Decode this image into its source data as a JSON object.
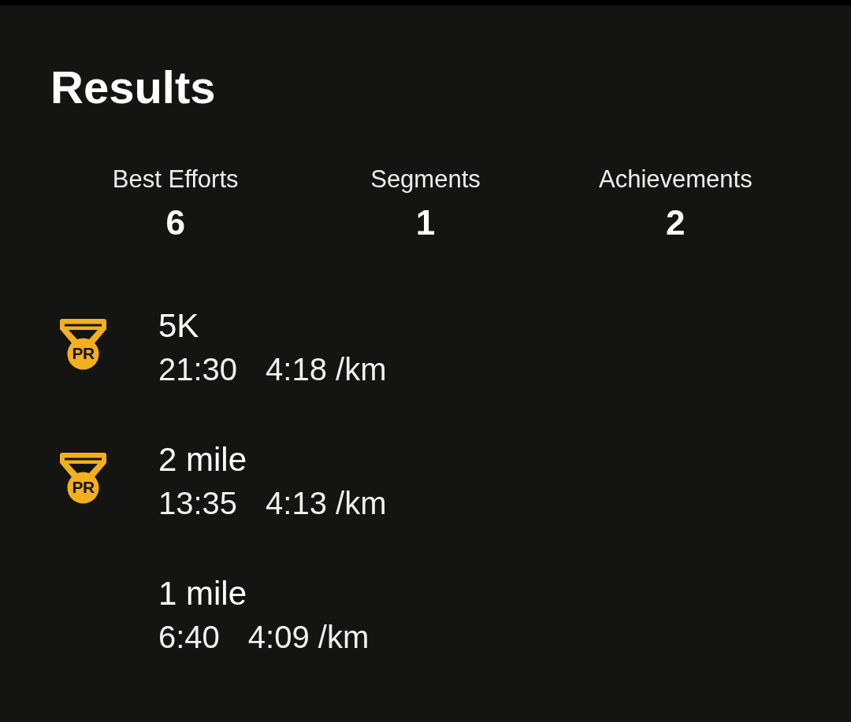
{
  "title": "Results",
  "stats": [
    {
      "label": "Best Efforts",
      "value": "6"
    },
    {
      "label": "Segments",
      "value": "1"
    },
    {
      "label": "Achievements",
      "value": "2"
    }
  ],
  "efforts": [
    {
      "badge": "PR",
      "name": "5K",
      "time": "21:30",
      "pace": "4:18 /km"
    },
    {
      "badge": "PR",
      "name": "2 mile",
      "time": "13:35",
      "pace": "4:13 /km"
    },
    {
      "name": "1 mile",
      "time": "6:40",
      "pace": "4:09 /km"
    }
  ]
}
